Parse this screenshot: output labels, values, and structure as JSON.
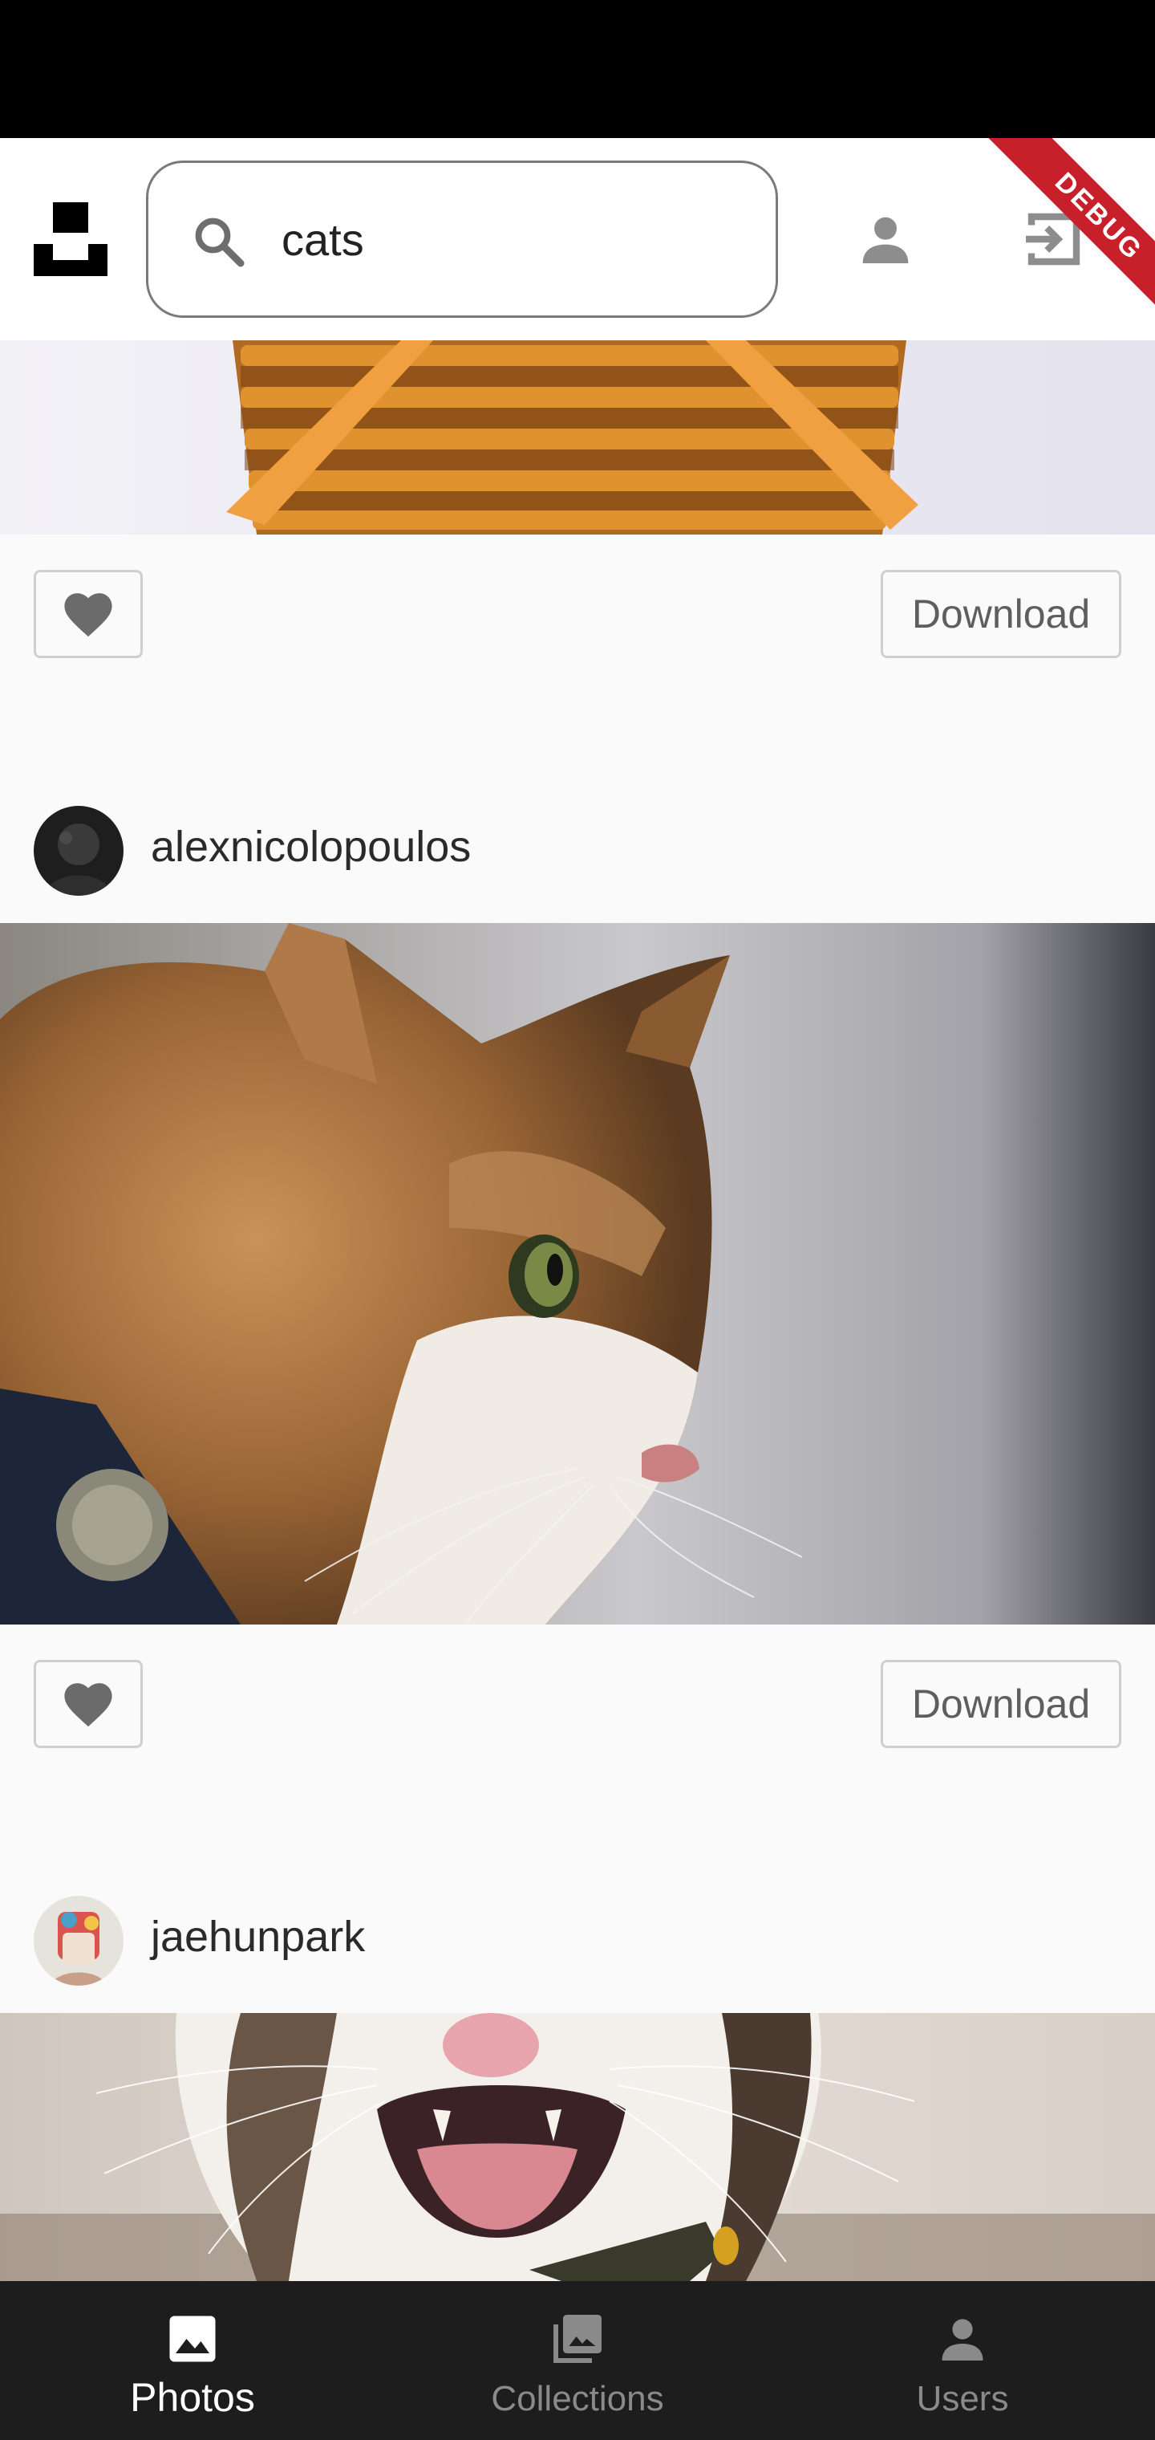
{
  "search": {
    "value": "cats"
  },
  "debug_banner": "DEBUG",
  "photos": [
    {
      "download_label": "Download"
    },
    {
      "author": "alexnicolopoulos",
      "download_label": "Download"
    },
    {
      "author": "jaehunpark"
    }
  ],
  "bottom_nav": {
    "items": [
      {
        "label": "Photos",
        "icon": "photo-icon",
        "active": true
      },
      {
        "label": "Collections",
        "icon": "collections-icon",
        "active": false
      },
      {
        "label": "Users",
        "icon": "user-icon",
        "active": false
      }
    ]
  },
  "colors": {
    "app_bar": "#ffffff",
    "background": "#fafafa",
    "bottom_nav": "#1d1d1d",
    "nav_active": "#ffffff",
    "nav_inactive": "#8a8a8a",
    "debug_ribbon": "#c8202b"
  }
}
